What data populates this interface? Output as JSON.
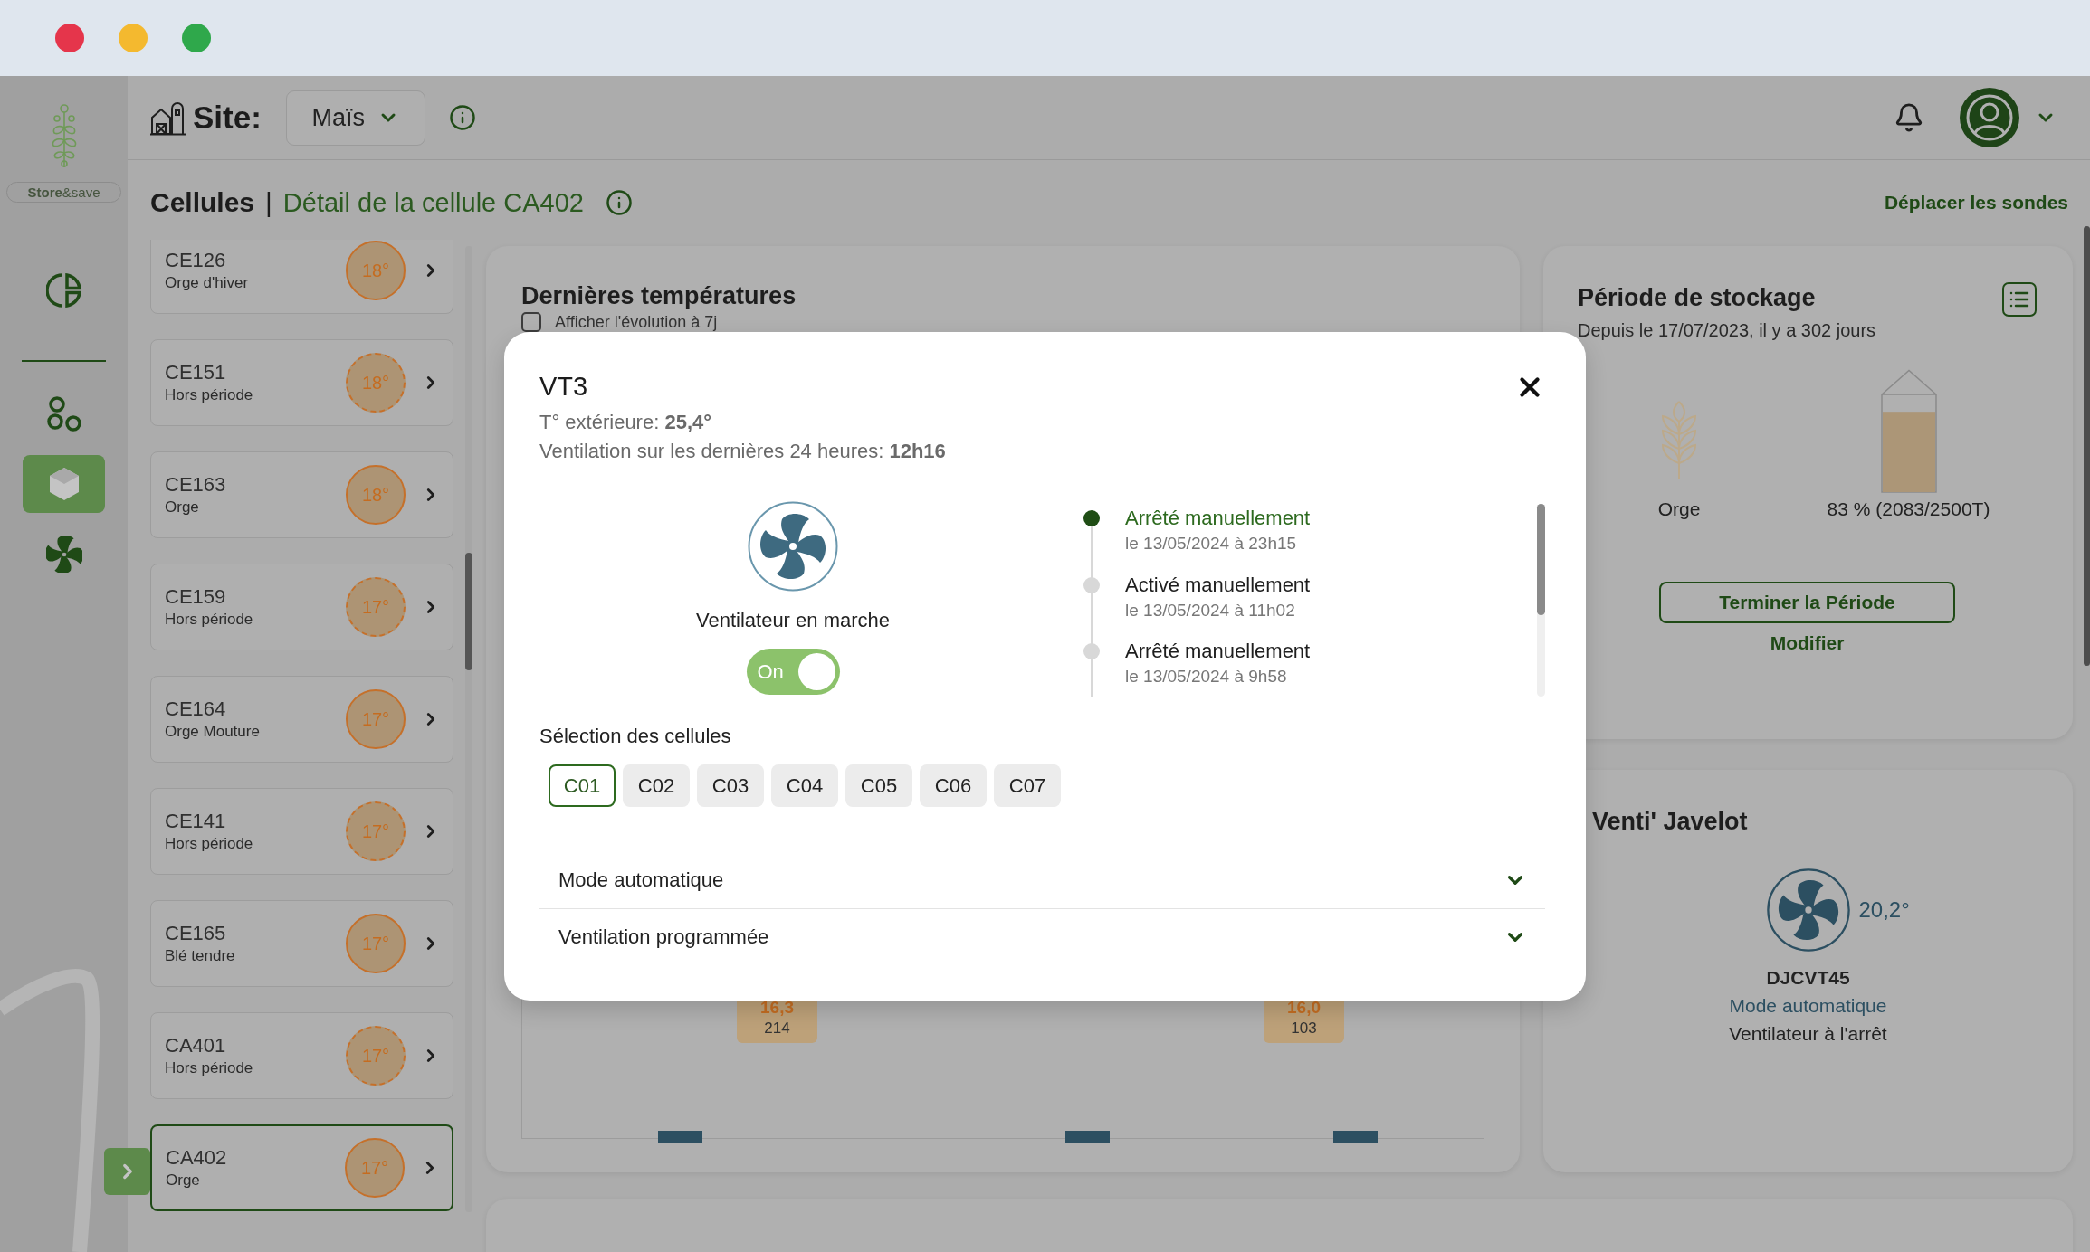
{
  "sidebar": {
    "logo": "**Store**&save",
    "items": [
      {
        "kind": "segments",
        "selected": false
      },
      {
        "kind": "circles",
        "selected": false
      },
      {
        "kind": "cube",
        "selected": true
      },
      {
        "kind": "fan",
        "selected": false
      }
    ]
  },
  "header": {
    "site_label": "Site:",
    "site": "Maïs"
  },
  "breadcrumb": {
    "section": "Cellules",
    "separator": "|",
    "page": "Détail de la cellule CA402",
    "link": "Déplacer les sondes"
  },
  "cells": [
    {
      "name": "CE126",
      "crop": "Orge d'hiver",
      "temperature": "18°",
      "in_period": true,
      "selected": false
    },
    {
      "name": "CE151",
      "crop": "Hors période",
      "temperature": "18°",
      "in_period": false,
      "selected": false
    },
    {
      "name": "CE163",
      "crop": "Orge",
      "temperature": "18°",
      "in_period": true,
      "selected": false
    },
    {
      "name": "CE159",
      "crop": "Hors période",
      "temperature": "17°",
      "in_period": false,
      "selected": false
    },
    {
      "name": "CE164",
      "crop": "Orge Mouture",
      "temperature": "17°",
      "in_period": true,
      "selected": false
    },
    {
      "name": "CE141",
      "crop": "Hors période",
      "temperature": "17°",
      "in_period": false,
      "selected": false
    },
    {
      "name": "CE165",
      "crop": "Blé tendre",
      "temperature": "17°",
      "in_period": true,
      "selected": false
    },
    {
      "name": "CA401",
      "crop": "Hors période",
      "temperature": "17°",
      "in_period": false,
      "selected": false
    },
    {
      "name": "CA402",
      "crop": "Orge",
      "temperature": "17°",
      "in_period": true,
      "selected": true
    }
  ],
  "temperatures": {
    "title": "Dernières températures",
    "checkbox": {
      "label": "Afficher l'évolution à 7j",
      "checked": false
    },
    "markers": [
      {
        "temperature": "16,3",
        "count": "214"
      },
      {
        "temperature": "16,0",
        "count": "103"
      }
    ]
  },
  "storage": {
    "title": "Période de stockage",
    "since": "Depuis le 17/07/2023, il y a 302 jours",
    "crop": "Orge",
    "fill": "83 % (2083/2500T)",
    "level": 0.83,
    "end_button": "Terminer la Période",
    "edit_link": "Modifier"
  },
  "fan": {
    "title": "Venti' Javelot",
    "temperature": "20,2°",
    "name": "DJCVT45",
    "mode": "Mode automatique",
    "status": "Ventilateur à l'arrêt"
  },
  "modal": {
    "title": "VT3",
    "outdoor": "T° extérieure: **25,4°**",
    "ventilation": "Ventilation sur les dernières 24 heures: **12h16**",
    "status": "Ventilateur en marche",
    "switch": {
      "label": "On",
      "on": true
    },
    "history": [
      {
        "event": "Arrêté manuellement",
        "date": "le 13/05/2024 à 23h15",
        "current": true
      },
      {
        "event": "Activé manuellement",
        "date": "le 13/05/2024 à 11h02",
        "current": false
      },
      {
        "event": "Arrêté manuellement",
        "date": "le 13/05/2024 à 9h58",
        "current": false
      }
    ],
    "cells_label": "Sélection des cellules",
    "cells": [
      {
        "label": "C01",
        "selected": true
      },
      {
        "label": "C02",
        "selected": false
      },
      {
        "label": "C03",
        "selected": false
      },
      {
        "label": "C04",
        "selected": false
      },
      {
        "label": "C05",
        "selected": false
      },
      {
        "label": "C06",
        "selected": false
      },
      {
        "label": "C07",
        "selected": false
      }
    ],
    "sections": [
      {
        "label": "Mode automatique",
        "expanded": false
      },
      {
        "label": "Ventilation programmée",
        "expanded": false
      }
    ]
  }
}
